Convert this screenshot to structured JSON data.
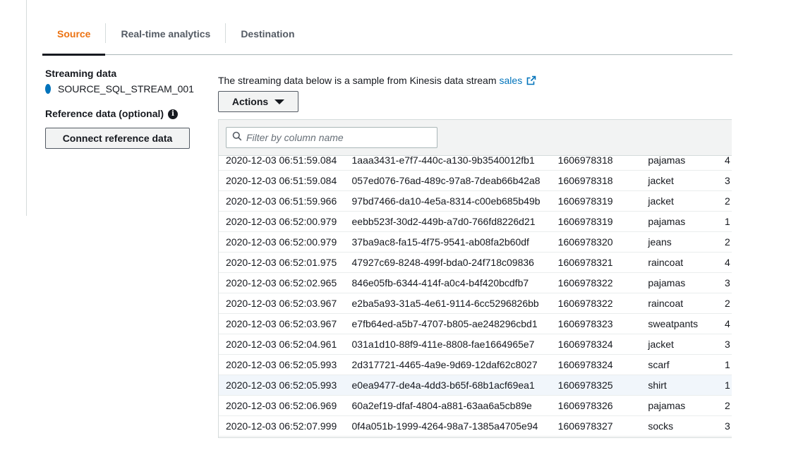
{
  "tabs": [
    {
      "label": "Source",
      "active": true
    },
    {
      "label": "Real-time analytics",
      "active": false
    },
    {
      "label": "Destination",
      "active": false
    }
  ],
  "sidebar": {
    "streaming_heading": "Streaming data",
    "stream_name": "SOURCE_SQL_STREAM_001",
    "reference_heading": "Reference data (optional)",
    "connect_button": "Connect reference data"
  },
  "main": {
    "sample_text": "The streaming data below is a sample from Kinesis data stream",
    "stream_link": "sales",
    "actions_button": "Actions"
  },
  "table": {
    "filter_placeholder": "Filter by column name",
    "rows": [
      [
        "2020-12-03 06:51:59.084",
        "1aaa3431-e7f7-440c-a130-9b3540012fb1",
        "1606978318",
        "pajamas",
        "4"
      ],
      [
        "2020-12-03 06:51:59.084",
        "057ed076-76ad-489c-97a8-7deab66b42a8",
        "1606978318",
        "jacket",
        "3"
      ],
      [
        "2020-12-03 06:51:59.966",
        "97bd7466-da10-4e5a-8314-c00eb685b49b",
        "1606978319",
        "jacket",
        "2"
      ],
      [
        "2020-12-03 06:52:00.979",
        "eebb523f-30d2-449b-a7d0-766fd8226d21",
        "1606978319",
        "pajamas",
        "1"
      ],
      [
        "2020-12-03 06:52:00.979",
        "37ba9ac8-fa15-4f75-9541-ab08fa2b60df",
        "1606978320",
        "jeans",
        "2"
      ],
      [
        "2020-12-03 06:52:01.975",
        "47927c69-8248-499f-bda0-24f718c09836",
        "1606978321",
        "raincoat",
        "4"
      ],
      [
        "2020-12-03 06:52:02.965",
        "846e05fb-6344-414f-a0c4-b4f420bcdfb7",
        "1606978322",
        "pajamas",
        "3"
      ],
      [
        "2020-12-03 06:52:03.967",
        "e2ba5a93-31a5-4e61-9114-6cc5296826bb",
        "1606978322",
        "raincoat",
        "2"
      ],
      [
        "2020-12-03 06:52:03.967",
        "e7fb64ed-a5b7-4707-b805-ae248296cbd1",
        "1606978323",
        "sweatpants",
        "4"
      ],
      [
        "2020-12-03 06:52:04.961",
        "031a1d10-88f9-411e-8808-fae1664965e7",
        "1606978324",
        "jacket",
        "3"
      ],
      [
        "2020-12-03 06:52:05.993",
        "2d317721-4465-4a9e-9d69-12daf62c8027",
        "1606978324",
        "scarf",
        "1"
      ],
      [
        "2020-12-03 06:52:05.993",
        "e0ea9477-de4a-4dd3-b65f-68b1acf69ea1",
        "1606978325",
        "shirt",
        "1"
      ],
      [
        "2020-12-03 06:52:06.969",
        "60a2ef19-dfaf-4804-a881-63aa6a5cb89e",
        "1606978326",
        "pajamas",
        "2"
      ],
      [
        "2020-12-03 06:52:07.999",
        "0f4a051b-1999-4264-98a7-1385a4705e94",
        "1606978327",
        "socks",
        "3"
      ]
    ],
    "highlighted_row": 11
  },
  "colors": {
    "accent": "#ec7211",
    "link": "#0073bb",
    "radio": "#0073bb",
    "row_highlight": "#f1f6fb"
  },
  "icons": {
    "external_link": "external-link-icon",
    "info": "info-icon",
    "search": "search-icon",
    "caret": "caret-down-icon"
  }
}
